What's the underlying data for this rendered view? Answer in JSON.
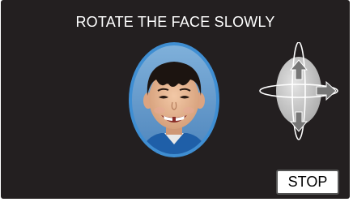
{
  "instruction": {
    "text": "ROTATE THE FACE SLOWLY"
  },
  "face_frame": {
    "border_color": "#3f8ed2",
    "content": "child-face-photo"
  },
  "rotation_guide": {
    "icon": "rotate-sphere-icon",
    "sphere_color": "#c9c9c9",
    "arrow_color": "#7a7a7a"
  },
  "buttons": {
    "stop_label": "STOP"
  },
  "colors": {
    "background": "#231f20",
    "text": "#ffffff",
    "button_background": "#ffffff",
    "button_text": "#000000"
  }
}
